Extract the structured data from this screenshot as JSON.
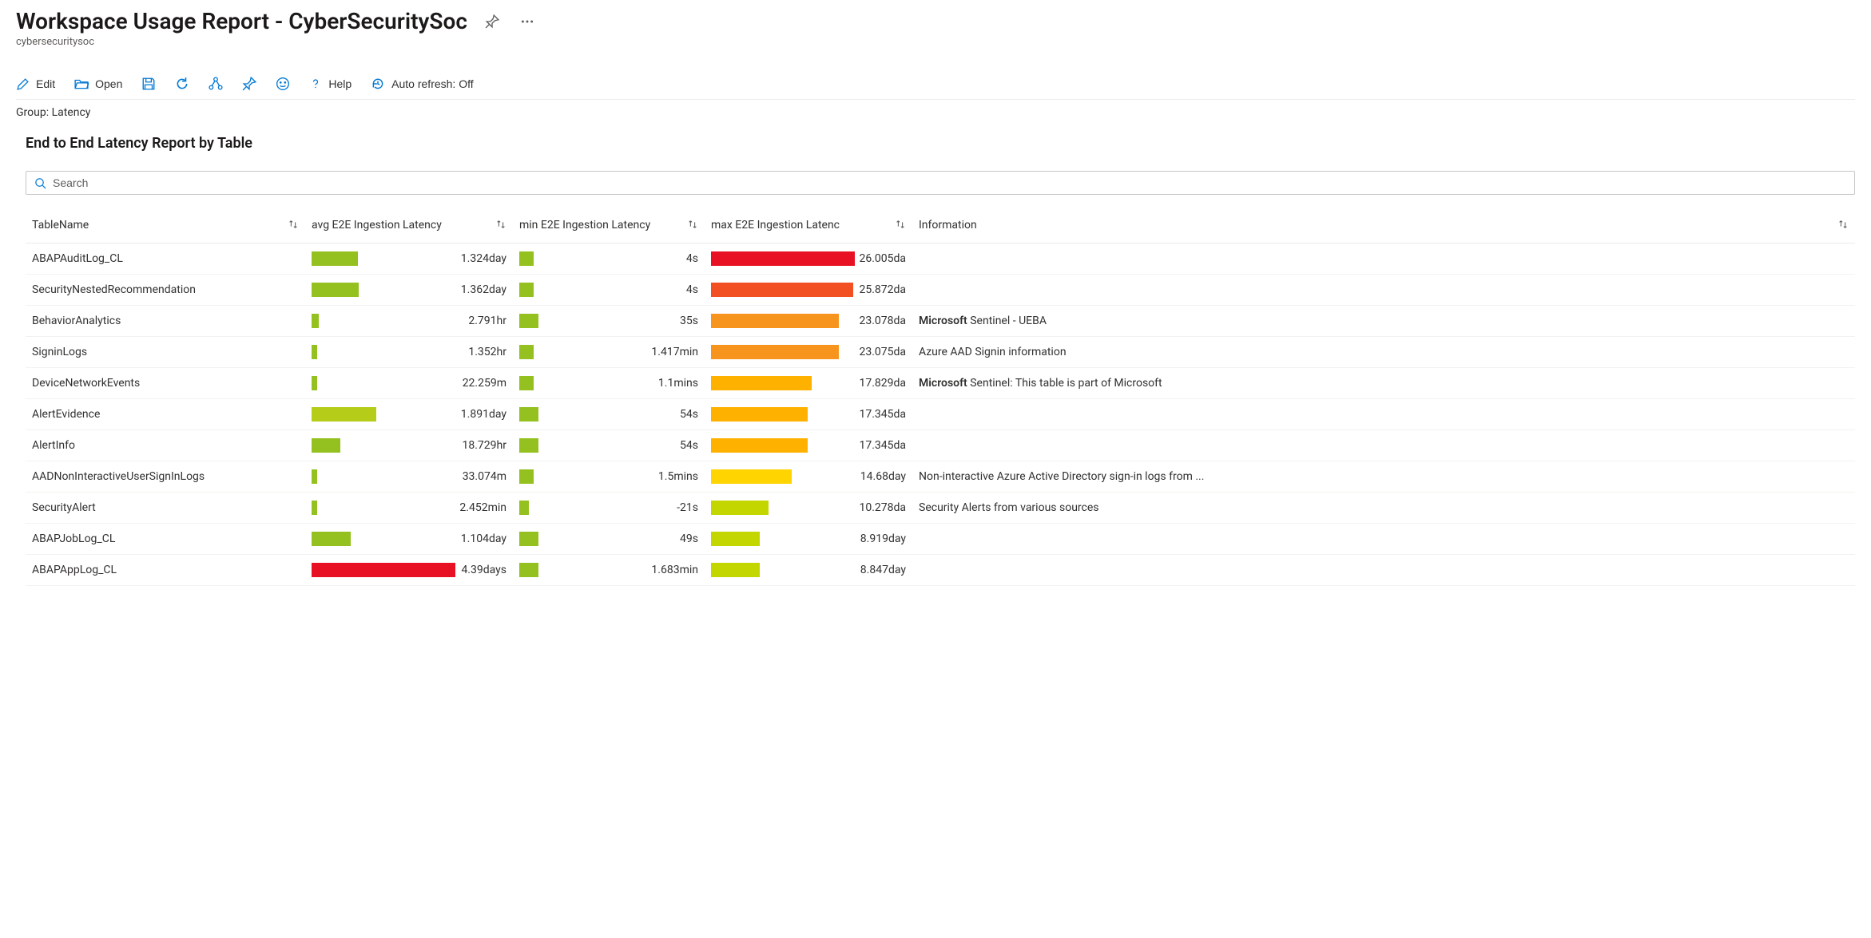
{
  "header": {
    "title": "Workspace Usage Report - CyberSecuritySoc",
    "subtitle": "cybersecuritysoc"
  },
  "toolbar": {
    "edit": "Edit",
    "open": "Open",
    "help": "Help",
    "auto_refresh": "Auto refresh: Off"
  },
  "group_label": "Group: Latency",
  "section_title": "End to End Latency Report by Table",
  "search": {
    "placeholder": "Search"
  },
  "columns": {
    "name": "TableName",
    "avg": "avg E2E Ingestion Latency",
    "min": "min E2E Ingestion Latency",
    "max": "max E2E Ingestion Latenc",
    "info": "Information"
  },
  "rows": [
    {
      "name": "ABAPAuditLog_CL",
      "avg_bar_pct": 32,
      "avg_color": "#94c11f",
      "avg_val": "1.324day",
      "min_bar_pct": 3,
      "min_color": "#94c11f",
      "min_val": "4s",
      "max_bar_pct": 100,
      "max_color": "#e81123",
      "max_val": "26.005da",
      "info_html": ""
    },
    {
      "name": "SecurityNestedRecommendation",
      "avg_bar_pct": 33,
      "avg_color": "#94c11f",
      "avg_val": "1.362day",
      "min_bar_pct": 3,
      "min_color": "#94c11f",
      "min_val": "4s",
      "max_bar_pct": 99,
      "max_color": "#f25022",
      "max_val": "25.872da",
      "info_html": ""
    },
    {
      "name": "BehaviorAnalytics",
      "avg_bar_pct": 5,
      "avg_color": "#94c11f",
      "avg_val": "2.791hr",
      "min_bar_pct": 4,
      "min_color": "#94c11f",
      "min_val": "35s",
      "max_bar_pct": 89,
      "max_color": "#f7941d",
      "max_val": "23.078da",
      "info_html": "<strong>Microsoft</strong> Sentinel - UEBA"
    },
    {
      "name": "SigninLogs",
      "avg_bar_pct": 4,
      "avg_color": "#94c11f",
      "avg_val": "1.352hr",
      "min_bar_pct": 3,
      "min_color": "#94c11f",
      "min_val": "1.417min",
      "max_bar_pct": 89,
      "max_color": "#f7941d",
      "max_val": "23.075da",
      "info_html": "Azure AAD Signin information"
    },
    {
      "name": "DeviceNetworkEvents",
      "avg_bar_pct": 4,
      "avg_color": "#94c11f",
      "avg_val": "22.259m",
      "min_bar_pct": 3,
      "min_color": "#94c11f",
      "min_val": "1.1mins",
      "max_bar_pct": 70,
      "max_color": "#ffb100",
      "max_val": "17.829da",
      "info_html": "<strong>Microsoft</strong> Sentinel: This table is part of Microsoft"
    },
    {
      "name": "AlertEvidence",
      "avg_bar_pct": 45,
      "avg_color": "#b5cc18",
      "avg_val": "1.891day",
      "min_bar_pct": 4,
      "min_color": "#94c11f",
      "min_val": "54s",
      "max_bar_pct": 67,
      "max_color": "#ffb100",
      "max_val": "17.345da",
      "info_html": ""
    },
    {
      "name": "AlertInfo",
      "avg_bar_pct": 20,
      "avg_color": "#94c11f",
      "avg_val": "18.729hr",
      "min_bar_pct": 4,
      "min_color": "#94c11f",
      "min_val": "54s",
      "max_bar_pct": 67,
      "max_color": "#ffb100",
      "max_val": "17.345da",
      "info_html": ""
    },
    {
      "name": "AADNonInteractiveUserSignInLogs",
      "avg_bar_pct": 4,
      "avg_color": "#94c11f",
      "avg_val": "33.074m",
      "min_bar_pct": 3,
      "min_color": "#94c11f",
      "min_val": "1.5mins",
      "max_bar_pct": 56,
      "max_color": "#ffd400",
      "max_val": "14.68day",
      "info_html": "Non-interactive Azure Active Directory sign-in logs from ..."
    },
    {
      "name": "SecurityAlert",
      "avg_bar_pct": 4,
      "avg_color": "#94c11f",
      "avg_val": "2.452min",
      "min_bar_pct": 2,
      "min_color": "#94c11f",
      "min_val": "-21s",
      "max_bar_pct": 40,
      "max_color": "#c4d600",
      "max_val": "10.278da",
      "info_html": "Security Alerts from various sources"
    },
    {
      "name": "ABAPJobLog_CL",
      "avg_bar_pct": 27,
      "avg_color": "#94c11f",
      "avg_val": "1.104day",
      "min_bar_pct": 4,
      "min_color": "#94c11f",
      "min_val": "49s",
      "max_bar_pct": 34,
      "max_color": "#c4d600",
      "max_val": "8.919day",
      "info_html": ""
    },
    {
      "name": "ABAPAppLog_CL",
      "avg_bar_pct": 100,
      "avg_color": "#e81123",
      "avg_val": "4.39days",
      "min_bar_pct": 4,
      "min_color": "#94c11f",
      "min_val": "1.683min",
      "max_bar_pct": 34,
      "max_color": "#c4d600",
      "max_val": "8.847day",
      "info_html": ""
    }
  ]
}
